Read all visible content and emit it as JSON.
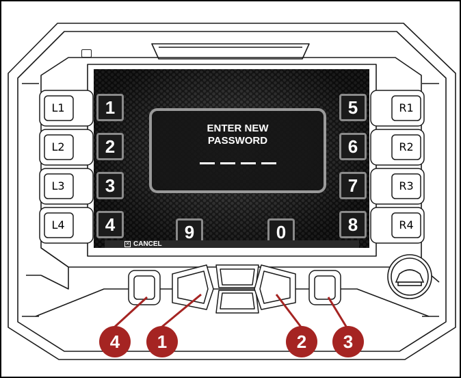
{
  "screen": {
    "dialog": {
      "title": "ENTER NEW\nPASSWORD",
      "password_slots": 4
    },
    "keys": {
      "k1": "1",
      "k2": "2",
      "k3": "3",
      "k4": "4",
      "k5": "5",
      "k6": "6",
      "k7": "7",
      "k8": "8",
      "k9": "9",
      "k0": "0"
    },
    "cancel_label": "CANCEL",
    "cancel_icon": "x-box-icon"
  },
  "side_buttons": {
    "left": [
      "L1",
      "L2",
      "L3",
      "L4"
    ],
    "right": [
      "R1",
      "R2",
      "R3",
      "R4"
    ]
  },
  "callouts": {
    "c1": "1",
    "c2": "2",
    "c3": "3",
    "c4": "4"
  },
  "colors": {
    "callout": "#a52422",
    "screen": "#181818",
    "key_border": "#8a8a8a"
  }
}
